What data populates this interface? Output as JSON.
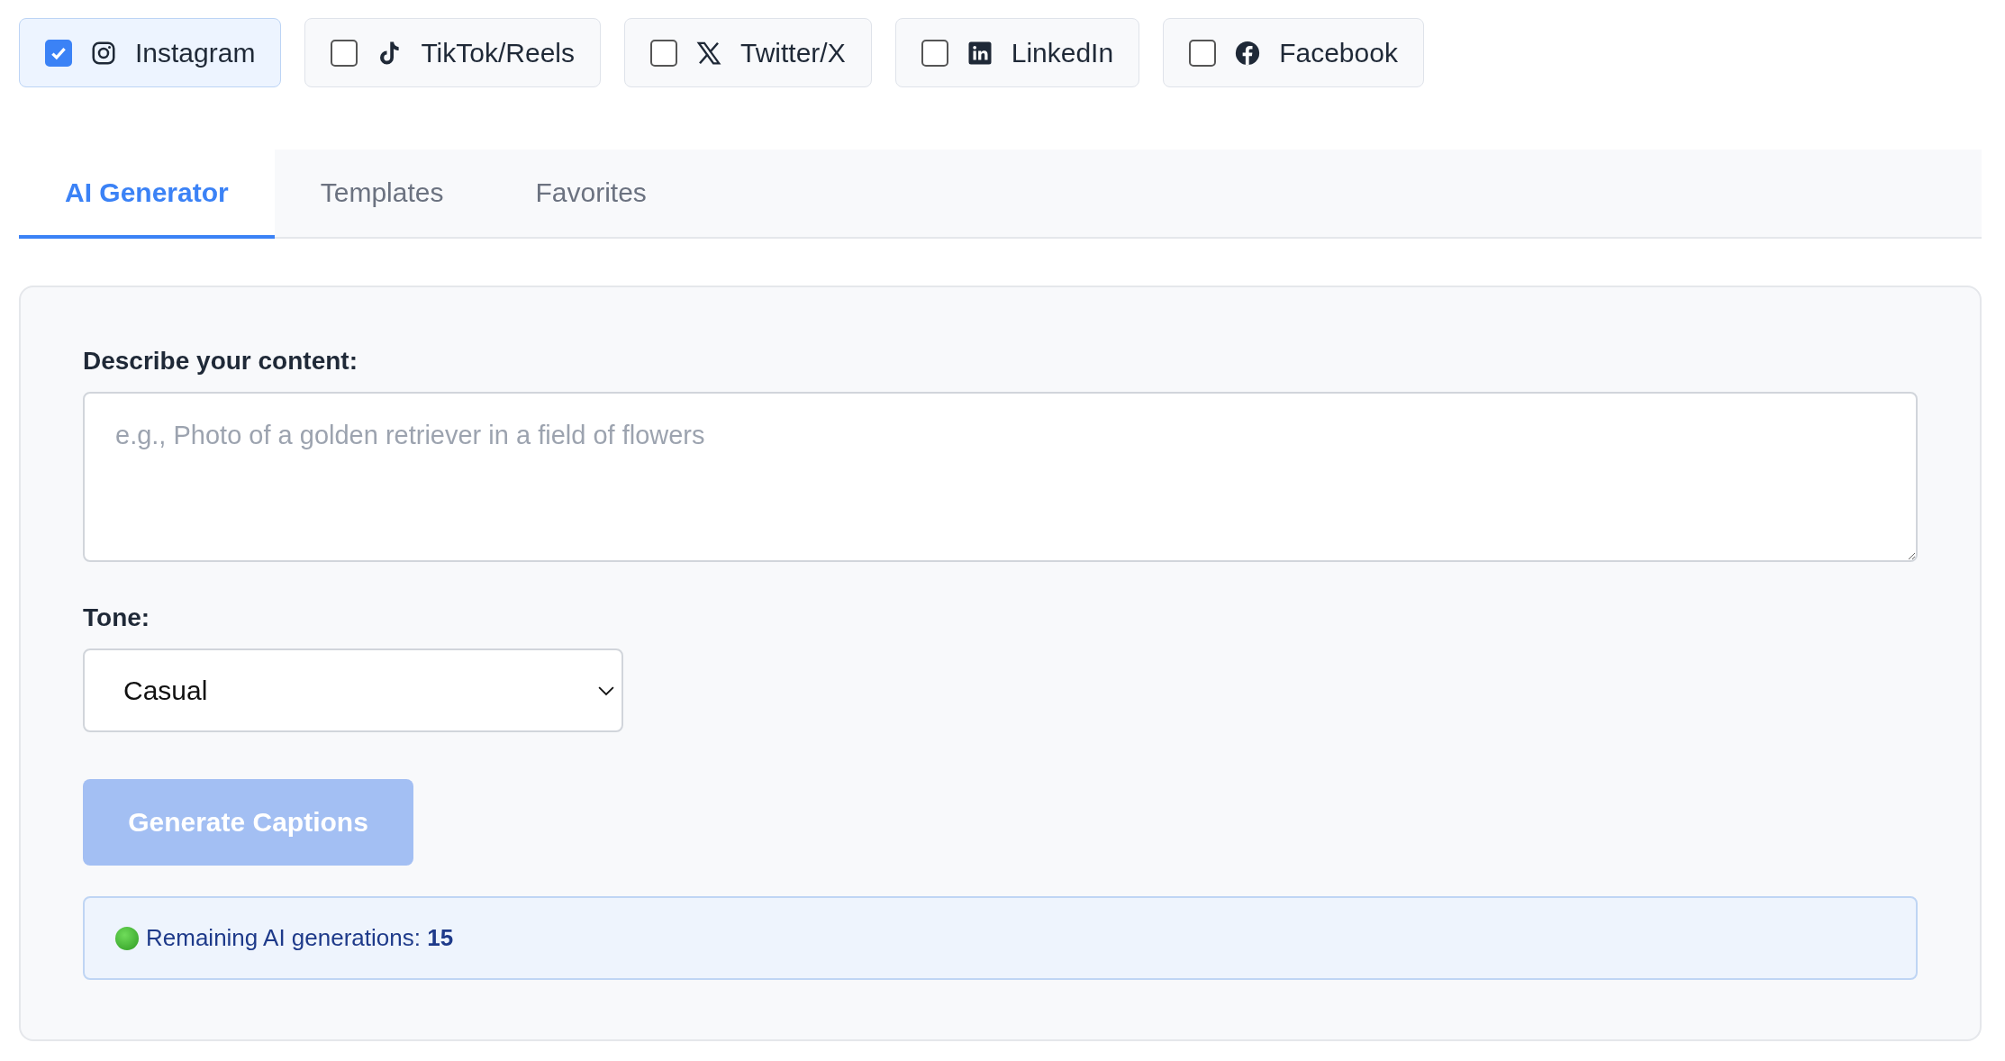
{
  "platforms": [
    {
      "label": "Instagram",
      "kind": "instagram",
      "checked": true
    },
    {
      "label": "TikTok/Reels",
      "kind": "tiktok",
      "checked": false
    },
    {
      "label": "Twitter/X",
      "kind": "x",
      "checked": false
    },
    {
      "label": "LinkedIn",
      "kind": "linkedin",
      "checked": false
    },
    {
      "label": "Facebook",
      "kind": "facebook",
      "checked": false
    }
  ],
  "tabs": [
    {
      "label": "AI Generator",
      "selected": true
    },
    {
      "label": "Templates",
      "selected": false
    },
    {
      "label": "Favorites",
      "selected": false
    }
  ],
  "form": {
    "content_label": "Describe your content:",
    "content_placeholder": "e.g., Photo of a golden retriever in a field of flowers",
    "tone_label": "Tone:",
    "tone_value": "Casual",
    "generate_button": {
      "label": "Generate Captions",
      "disabled": true
    },
    "notice": "Remaining AI generations: **15**"
  }
}
